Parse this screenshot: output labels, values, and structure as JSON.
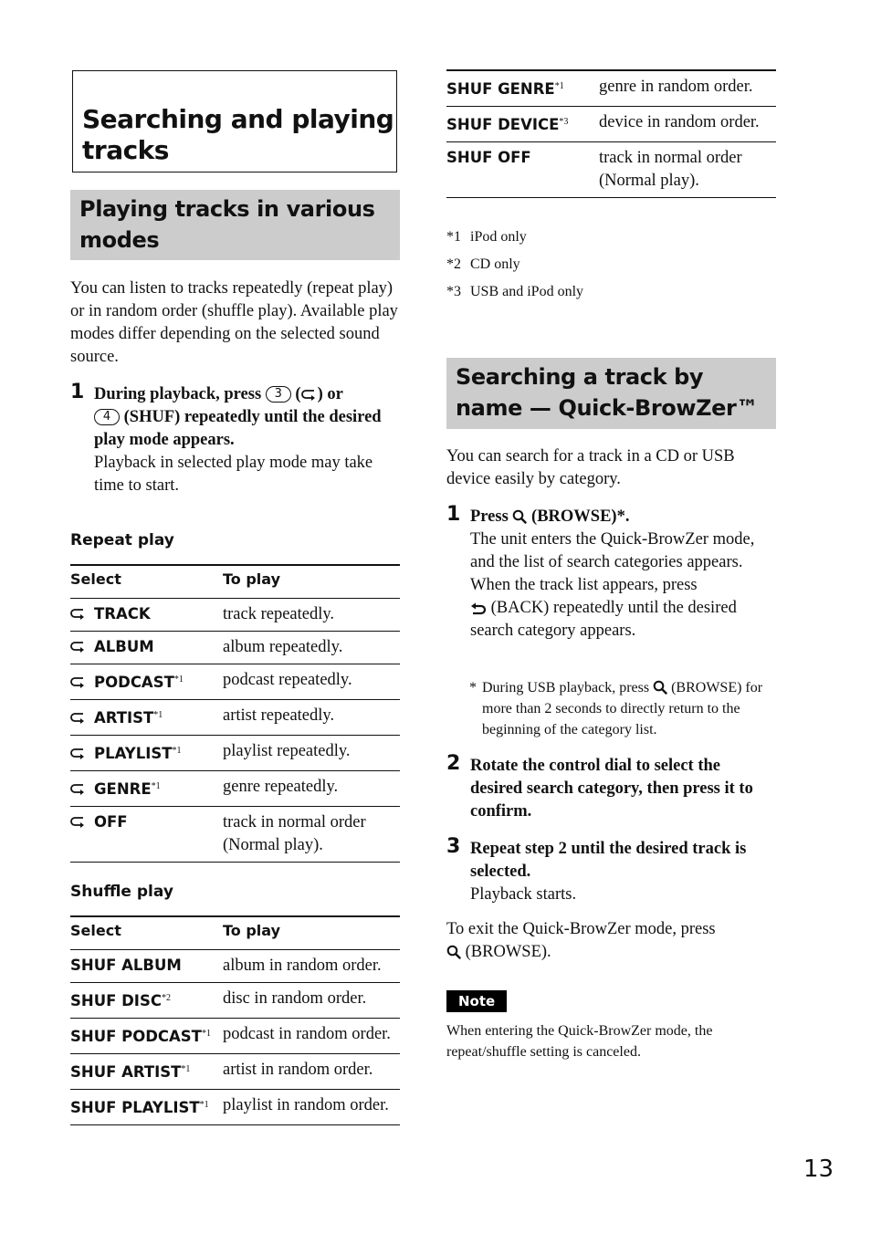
{
  "page": {
    "title": "Searching and playing tracks",
    "page_number": "13"
  },
  "section_play_modes": {
    "heading": "Playing tracks in various modes",
    "intro": "You can listen to tracks repeatedly (repeat play) or in random order (shuffle play). Available play modes differ depending on the selected sound source.",
    "step1": {
      "number": "1",
      "text_a": "During playback, press",
      "key_a": "3",
      "key_a_icon": "repeat-icon",
      "text_b": "or",
      "key_b": "4",
      "text_c": "(SHUF) repeatedly until the desired play mode appears.",
      "detail": "Playback in selected play mode may take time to start."
    },
    "repeat_play": {
      "heading": "Repeat play",
      "columns": [
        "Select",
        "To play"
      ],
      "rows": [
        {
          "icon": "repeat-icon",
          "select": "TRACK",
          "footnote": "",
          "to_play": "track repeatedly."
        },
        {
          "icon": "repeat-icon",
          "select": "ALBUM",
          "footnote": "",
          "to_play": "album repeatedly."
        },
        {
          "icon": "repeat-icon",
          "select": "PODCAST",
          "footnote": "*1",
          "to_play": "podcast repeatedly."
        },
        {
          "icon": "repeat-icon",
          "select": "ARTIST",
          "footnote": "*1",
          "to_play": "artist repeatedly."
        },
        {
          "icon": "repeat-icon",
          "select": "PLAYLIST",
          "footnote": "*1",
          "to_play": "playlist repeatedly."
        },
        {
          "icon": "repeat-icon",
          "select": "GENRE",
          "footnote": "*1",
          "to_play": "genre repeatedly."
        },
        {
          "icon": "repeat-icon",
          "select": "OFF",
          "footnote": "",
          "to_play": "track in normal order (Normal play)."
        }
      ]
    },
    "shuffle_play": {
      "heading": "Shuffle play",
      "columns": [
        "Select",
        "To play"
      ],
      "rows_left": [
        {
          "select": "SHUF ALBUM",
          "footnote": "",
          "to_play": "album in random order."
        },
        {
          "select": "SHUF DISC",
          "footnote": "*2",
          "to_play": "disc in random order."
        },
        {
          "select": "SHUF PODCAST",
          "footnote": "*1",
          "to_play": "podcast in random order."
        },
        {
          "select": "SHUF ARTIST",
          "footnote": "*1",
          "to_play": "artist in random order."
        },
        {
          "select": "SHUF PLAYLIST",
          "footnote": "*1",
          "to_play": "playlist in random order."
        }
      ],
      "rows_right": [
        {
          "select": "SHUF GENRE",
          "footnote": "*1",
          "to_play": "genre in random order."
        },
        {
          "select": "SHUF DEVICE",
          "footnote": "*3",
          "to_play": "device in random order."
        },
        {
          "select": "SHUF OFF",
          "footnote": "",
          "to_play": "track in normal order (Normal play)."
        }
      ]
    },
    "footnotes": [
      {
        "mark": "*1",
        "text": "iPod only"
      },
      {
        "mark": "*2",
        "text": "CD only"
      },
      {
        "mark": "*3",
        "text": "USB and iPod only"
      }
    ]
  },
  "section_quick_browzer": {
    "heading_line1": "Searching a track by",
    "heading_line2": "name — Quick-BrowZer™",
    "intro": "You can search for a track in a CD or USB device easily by category.",
    "step1": {
      "number": "1",
      "title_a": "Press",
      "title_icon": "search-icon",
      "title_b": "(BROWSE)*.",
      "detail_1": "The unit enters the Quick-BrowZer mode, and the list of search categories appears.",
      "detail_2a": "When the track list appears, press",
      "detail_icon": "back-icon",
      "detail_2b": "(BACK) repeatedly until the desired search category appears.",
      "note_mark": "*",
      "note_a": "During USB playback, press",
      "note_icon": "search-icon",
      "note_b": "(BROWSE) for more than 2 seconds to directly return to the beginning of the category list."
    },
    "step2": {
      "number": "2",
      "title": "Rotate the control dial to select the desired search category, then press it to confirm."
    },
    "step3": {
      "number": "3",
      "title": "Repeat step 2 until the desired track is selected.",
      "detail": "Playback starts."
    },
    "exit_text_a": "To exit the Quick-BrowZer mode, press",
    "exit_icon": "search-icon",
    "exit_text_b": "(BROWSE).",
    "note_label": "Note",
    "note_text": "When entering the Quick-BrowZer mode, the repeat/shuffle setting is canceled."
  }
}
